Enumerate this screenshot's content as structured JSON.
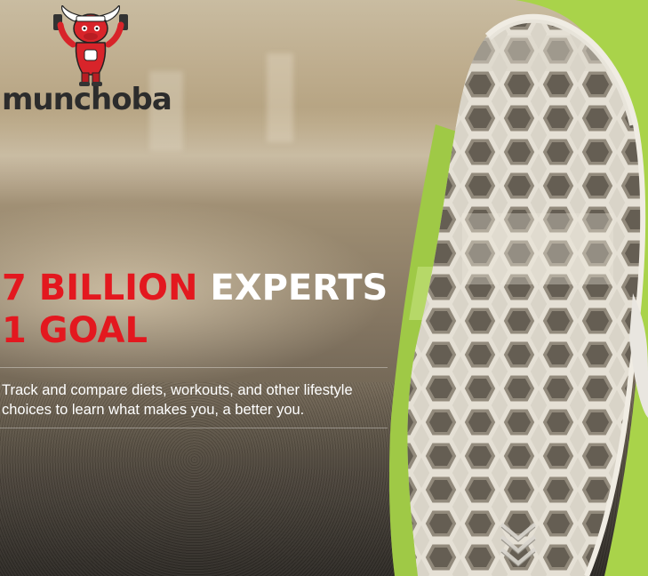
{
  "brand": {
    "name": "munchoba",
    "mascot_icon": "red-bull-mascot-icon"
  },
  "headline": {
    "line1_red": "7 BILLION",
    "line1_white": "EXPERTS",
    "line2_red": "1 GOAL"
  },
  "tagline": "Track and compare diets, workouts, and other lifestyle choices to learn what makes you, a better you.",
  "scroll": {
    "icon": "chevron-down-icon"
  },
  "colors": {
    "accent_red": "#e3181f",
    "shoe_green": "#a9d34a",
    "sole_gray": "#bdb7aa",
    "brand_text": "#2c2c2c"
  }
}
